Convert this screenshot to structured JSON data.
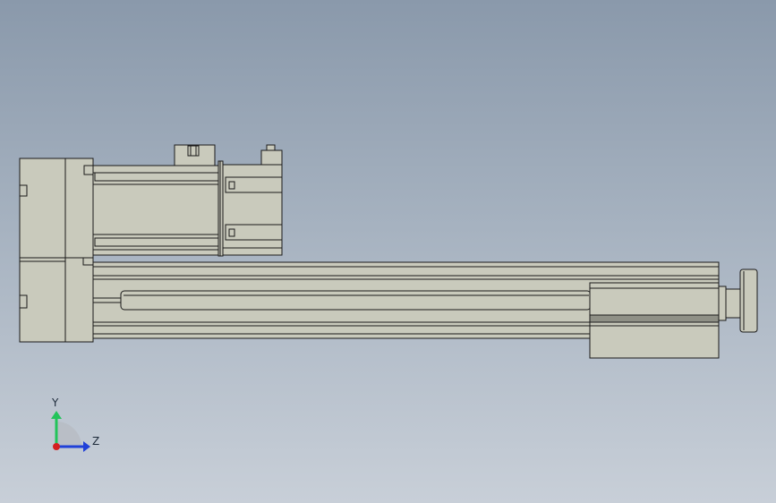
{
  "viewport": {
    "background_top": "#8a99ab",
    "background_bottom": "#c8cfd8"
  },
  "model": {
    "shaded_color": "#c9cabc",
    "edge_color": "#1a1a1a",
    "description_icon": "linear-actuator-with-servo-motor"
  },
  "triad": {
    "y_label": "Y",
    "z_label": "Z",
    "y_color": "#22c45a",
    "z_color": "#2040d8",
    "x_color": "#d42020"
  }
}
